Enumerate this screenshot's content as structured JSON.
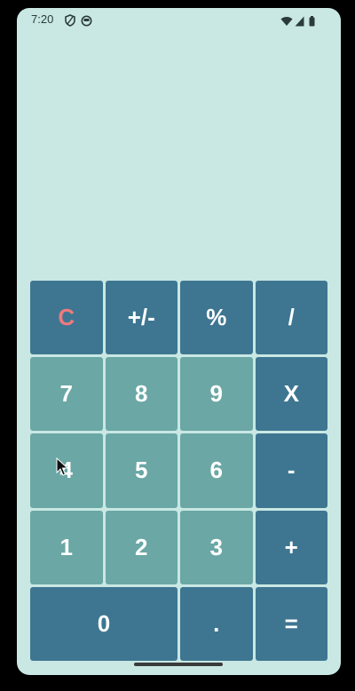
{
  "status_bar": {
    "time": "7:20",
    "left_icons": [
      "shield-icon",
      "circle-face-icon"
    ],
    "right_icons": [
      "wifi-icon",
      "cell-signal-icon",
      "battery-icon"
    ]
  },
  "display": {
    "value": ""
  },
  "keypad": {
    "rows": [
      [
        "C",
        "+/-",
        "%",
        "/"
      ],
      [
        "7",
        "8",
        "9",
        "X"
      ],
      [
        "4",
        "5",
        "6",
        "-"
      ],
      [
        "1",
        "2",
        "3",
        "+"
      ],
      [
        "0",
        ".",
        "="
      ]
    ]
  },
  "colors": {
    "background": "#c9e8e4",
    "function_key": "#3e7691",
    "number_key": "#6aa7a5",
    "clear_text": "#f07a7d",
    "key_text": "#ffffff"
  }
}
